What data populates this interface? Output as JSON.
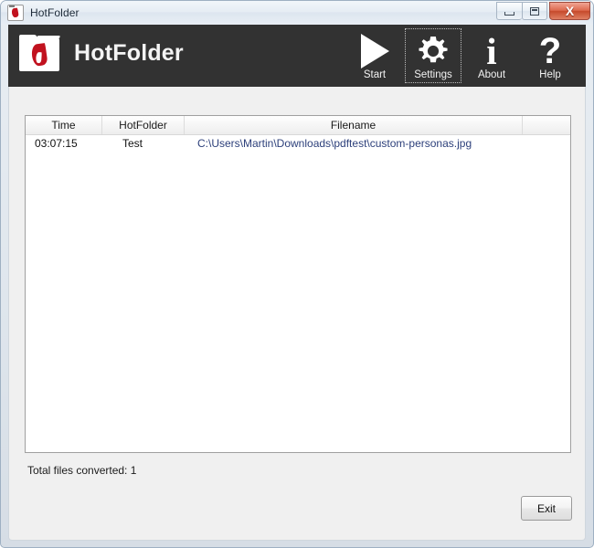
{
  "window": {
    "title": "HotFolder",
    "icon": "hotfolder-flame-icon",
    "controls": {
      "minimize_label": "–",
      "maximize_label": "□",
      "close_label": "X"
    }
  },
  "header": {
    "brand_name": "HotFolder",
    "logo_icon": "folder-flame-logo",
    "toolbar": [
      {
        "id": "start",
        "label": "Start",
        "icon": "play-icon",
        "focused": false
      },
      {
        "id": "settings",
        "label": "Settings",
        "icon": "gear-icon",
        "focused": true
      },
      {
        "id": "about",
        "label": "About",
        "icon": "info-icon",
        "focused": false
      },
      {
        "id": "help",
        "label": "Help",
        "icon": "question-icon",
        "focused": false
      }
    ]
  },
  "list": {
    "columns": [
      {
        "key": "time",
        "label": "Time"
      },
      {
        "key": "hotfolder",
        "label": "HotFolder"
      },
      {
        "key": "filename",
        "label": "Filename"
      },
      {
        "key": "extra",
        "label": ""
      }
    ],
    "rows": [
      {
        "time": "03:07:15",
        "hotfolder": "Test",
        "filename": "C:\\Users\\Martin\\Downloads\\pdftest\\custom-personas.jpg"
      }
    ]
  },
  "status": {
    "total_files_converted_label": "Total files converted:  1"
  },
  "footer": {
    "exit_label": "Exit"
  },
  "colors": {
    "header_background": "#323232",
    "content_background": "#f0f0f0",
    "list_background": "#ffffff",
    "filename_link": "#2c3f7a",
    "flame_red": "#c1121f",
    "close_button": "#c64a2c"
  }
}
